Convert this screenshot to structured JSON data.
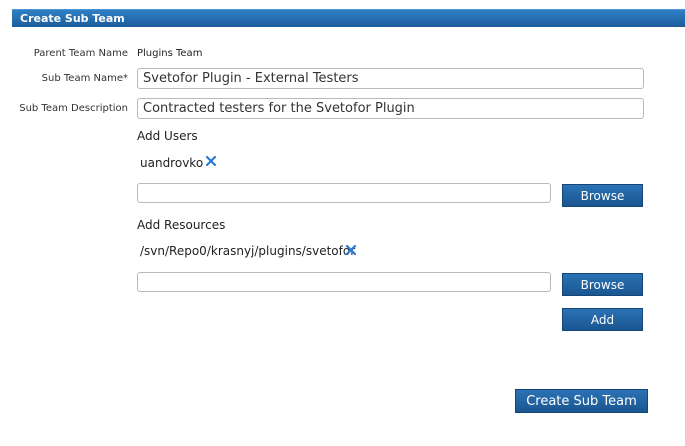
{
  "dialog": {
    "title": "Create Sub Team"
  },
  "form": {
    "parent_team_label": "Parent Team Name",
    "parent_team_value": "Plugins Team",
    "sub_team_name_label": "Sub Team Name*",
    "sub_team_name_value": "Svetofor Plugin - External Testers",
    "sub_team_description_label": "Sub Team Description",
    "sub_team_description_value": "Contracted testers for the Svetofor Plugin"
  },
  "users": {
    "heading": "Add Users",
    "items": [
      {
        "label": "uandrovko"
      }
    ],
    "input_value": "",
    "browse_label": "Browse"
  },
  "resources": {
    "heading": "Add Resources",
    "items": [
      {
        "label": "/svn/Repo0/krasnyj/plugins/svetofor"
      }
    ],
    "input_value": "",
    "browse_label": "Browse",
    "add_label": "Add"
  },
  "footer": {
    "create_label": "Create Sub Team"
  },
  "colors": {
    "accent": "#1f63a5",
    "remove_icon": "#2a7ad8"
  }
}
